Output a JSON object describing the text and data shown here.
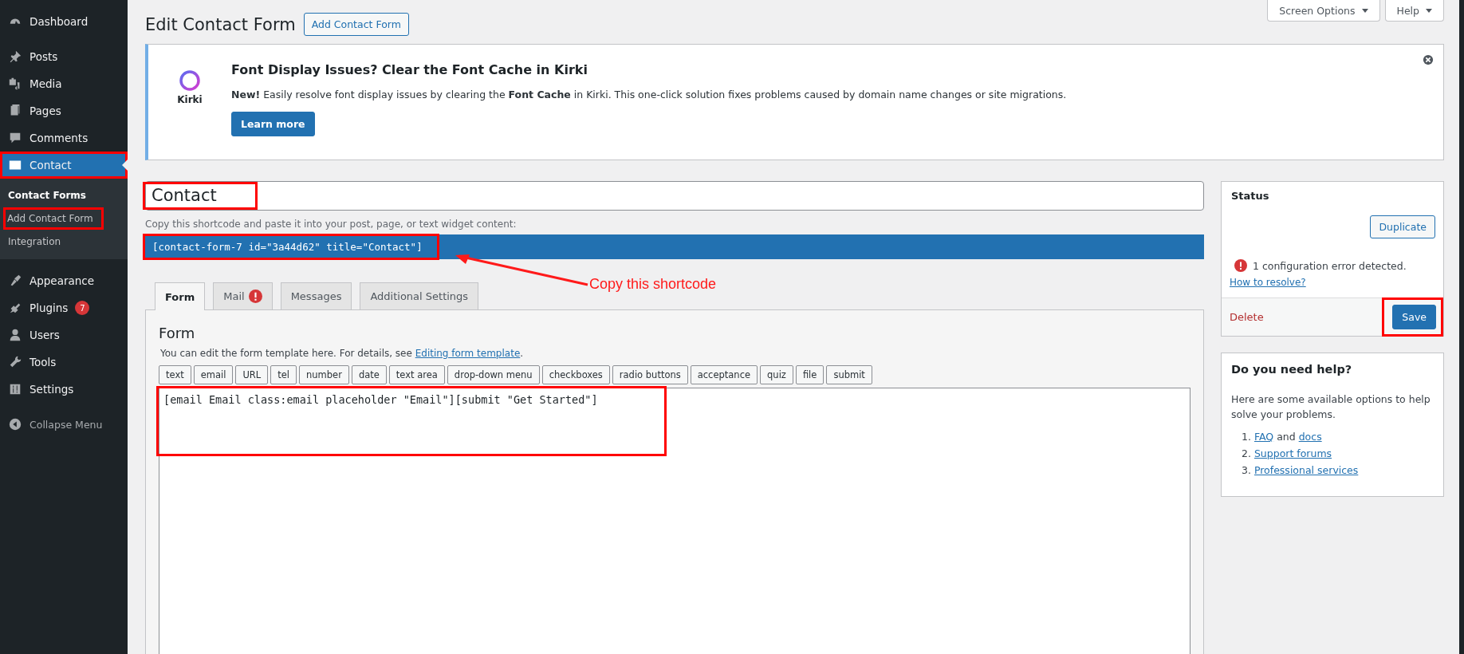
{
  "sidebar": {
    "groups": [
      [
        {
          "label": "Dashboard",
          "selected": false,
          "highlighted": false
        }
      ],
      [
        {
          "label": "Posts",
          "selected": false,
          "highlighted": false
        },
        {
          "label": "Media",
          "selected": false,
          "highlighted": false
        },
        {
          "label": "Pages",
          "selected": false,
          "highlighted": false
        },
        {
          "label": "Comments",
          "selected": false,
          "highlighted": false
        },
        {
          "label": "Contact",
          "selected": true,
          "highlighted": true,
          "children": [
            {
              "label": "Contact Forms",
              "selected": true,
              "highlighted": false
            },
            {
              "label": "Add Contact Form",
              "selected": false,
              "highlighted": true
            },
            {
              "label": "Integration",
              "selected": false,
              "highlighted": false
            }
          ]
        }
      ],
      [
        {
          "label": "Appearance",
          "selected": false,
          "highlighted": false
        },
        {
          "label": "Plugins",
          "selected": false,
          "highlighted": false,
          "badge": "7"
        },
        {
          "label": "Users",
          "selected": false,
          "highlighted": false
        },
        {
          "label": "Tools",
          "selected": false,
          "highlighted": false
        },
        {
          "label": "Settings",
          "selected": false,
          "highlighted": false
        }
      ]
    ],
    "collapse": "Collapse Menu"
  },
  "top_buttons": [
    "Screen Options",
    "Help"
  ],
  "header": {
    "title": "Edit Contact Form",
    "button": "Add Contact Form"
  },
  "notice": {
    "logo_text": "Kirki",
    "title": "Font Display Issues? Clear the Font Cache in Kirki",
    "body": "**New!** Easily resolve font display issues by clearing the **Font Cache** in Kirki. This one-click solution fixes problems caused by domain name changes or site migrations.",
    "button": "Learn more"
  },
  "form_title": {
    "value": "Contact",
    "highlighted": true
  },
  "shortcode": {
    "hint": "Copy this shortcode and paste it into your post, page, or text widget content:",
    "value": "[contact-form-7 id=\"3a44d62\" title=\"Contact\"]",
    "highlighted": true
  },
  "annotation": {
    "text": "Copy this shortcode"
  },
  "tabs": [
    {
      "label": "Form",
      "selected": true,
      "error": false
    },
    {
      "label": "Mail",
      "selected": false,
      "error": true
    },
    {
      "label": "Messages",
      "selected": false,
      "error": false
    },
    {
      "label": "Additional Settings",
      "selected": false,
      "error": false
    }
  ],
  "panel": {
    "heading": "Form",
    "description": "You can edit the form template here. For details, see ",
    "link": "Editing form template",
    "after": ".",
    "tags": [
      "text",
      "email",
      "URL",
      "tel",
      "number",
      "date",
      "text area",
      "drop-down menu",
      "checkboxes",
      "radio buttons",
      "acceptance",
      "quiz",
      "file",
      "submit"
    ],
    "template": {
      "value": "[email Email class:email placeholder \"Email\"][submit \"Get Started\"]",
      "highlighted": true
    }
  },
  "status": {
    "title": "Status",
    "duplicate": "Duplicate",
    "error": "1 configuration error detected.",
    "resolve": "How to resolve?",
    "delete": "Delete",
    "save": "Save",
    "save_highlighted": true
  },
  "help": {
    "title": "Do you need help?",
    "text": "Here are some available options to help solve your problems.",
    "items": [
      {
        "number": "1.",
        "parts": [
          {
            "kind": "link",
            "text": "FAQ"
          },
          {
            "kind": "plain",
            "text": "and"
          },
          {
            "kind": "link",
            "text": "docs"
          }
        ]
      },
      {
        "number": "2.",
        "parts": [
          {
            "kind": "link",
            "text": "Support forums"
          }
        ]
      },
      {
        "number": "3.",
        "parts": [
          {
            "kind": "link",
            "text": "Professional services"
          }
        ]
      }
    ]
  }
}
